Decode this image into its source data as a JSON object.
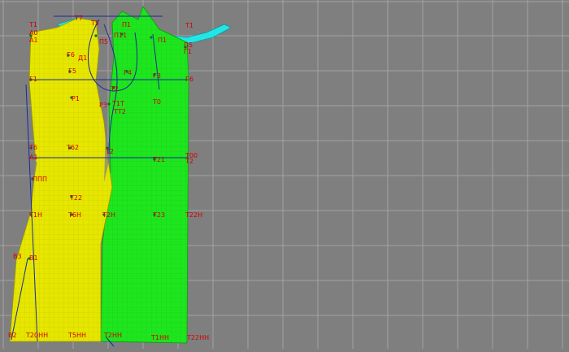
{
  "app": {
    "view": "pattern-drafting-canvas"
  },
  "colors": {
    "background": "#7f7f7f",
    "grid": "#a3a3a3",
    "front_panel": "#e6e600",
    "back_panel": "#1ee61e",
    "sleeve": "#22e6e6",
    "label": "#d20000",
    "construction_line": "#1a2a9a",
    "point": "#0a6a3a"
  },
  "labels": {
    "top_t1": "Т1",
    "top_t7": "Т7",
    "top_t5": "Т5",
    "top_t1r": "Т1",
    "a0": "А0",
    "a1": "А1",
    "a2": "А2",
    "p1": "П1",
    "p11": "П11",
    "p1r": "П1",
    "p5": "П5",
    "ps": "П5",
    "d1": "Д1",
    "g1": "Г1",
    "gb": "Г6",
    "g4": "Г4",
    "g5": "Г5",
    "g6": "Г6",
    "g3": "Г3",
    "gn": "Г1",
    "t2": "Т2",
    "r1": "Р1",
    "r3": "Р3",
    "t0": "Т0",
    "t2r": "Т2",
    "t1t": "Т1Т",
    "tt2": "ТТ2",
    "t6": "Т6",
    "t62": "Т62",
    "t00": "Т00",
    "t2b": "Т2",
    "ppd": "ППП",
    "a1b": "А1",
    "t2bb": "Т2",
    "t21": "Т21",
    "t22": "Т22",
    "t1n": "Т1Н",
    "t6n": "Т6Н",
    "t2n": "Т2Н",
    "t23": "Т23",
    "t1h": "Т1Н",
    "t22h": "Т22Н",
    "b3": "В3",
    "b1": "В1",
    "b2": "В2",
    "h20": "Т20НН",
    "h5": "Т5НН",
    "h2": "Т2НН",
    "h1": "Т1НН",
    "h22": "Т22НН"
  }
}
